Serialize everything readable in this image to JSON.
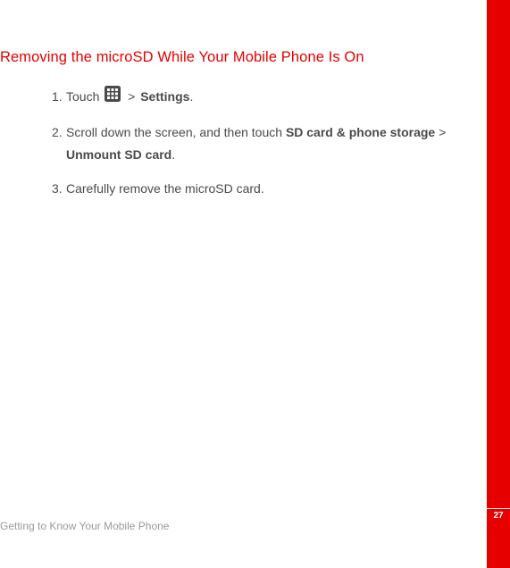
{
  "heading": "Removing the microSD While Your Mobile Phone Is On",
  "steps": {
    "s1": {
      "num": "1.",
      "prefix": "Touch ",
      "arrow": " > ",
      "setting": "Settings",
      "suffix": "."
    },
    "s2": {
      "num": "2.",
      "prefix": "Scroll down the screen, and then touch ",
      "bold1": "SD card & phone storage",
      "arrow": " > ",
      "bold2": "Unmount SD card",
      "suffix": "."
    },
    "s3": {
      "num": "3.",
      "text": "Carefully remove the microSD card."
    }
  },
  "footer": "Getting to Know Your Mobile Phone",
  "page_number": "27"
}
